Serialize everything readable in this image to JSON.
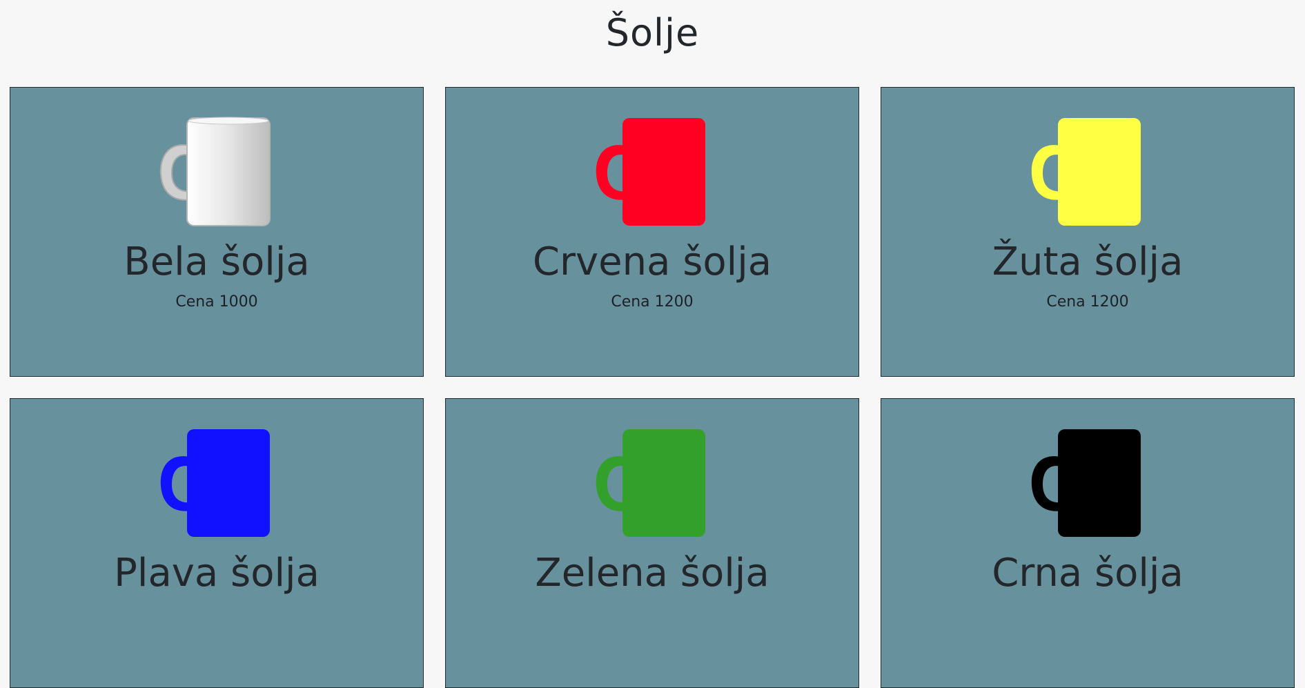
{
  "page": {
    "title": "Šolje"
  },
  "products": [
    {
      "name": "Bela šolja",
      "price_label": "Cena 1000",
      "color": "#f0f0f0",
      "icon": "white-mug-icon"
    },
    {
      "name": "Crvena šolja",
      "price_label": "Cena 1200",
      "color": "#ff0022",
      "icon": "red-mug-icon"
    },
    {
      "name": "Žuta šolja",
      "price_label": "Cena 1200",
      "color": "#ffff44",
      "icon": "yellow-mug-icon"
    },
    {
      "name": "Plava šolja",
      "price_label": "",
      "color": "#1111ff",
      "icon": "blue-mug-icon"
    },
    {
      "name": "Zelena šolja",
      "price_label": "",
      "color": "#33a02c",
      "icon": "green-mug-icon"
    },
    {
      "name": "Crna šolja",
      "price_label": "",
      "color": "#000000",
      "icon": "black-mug-icon"
    }
  ]
}
